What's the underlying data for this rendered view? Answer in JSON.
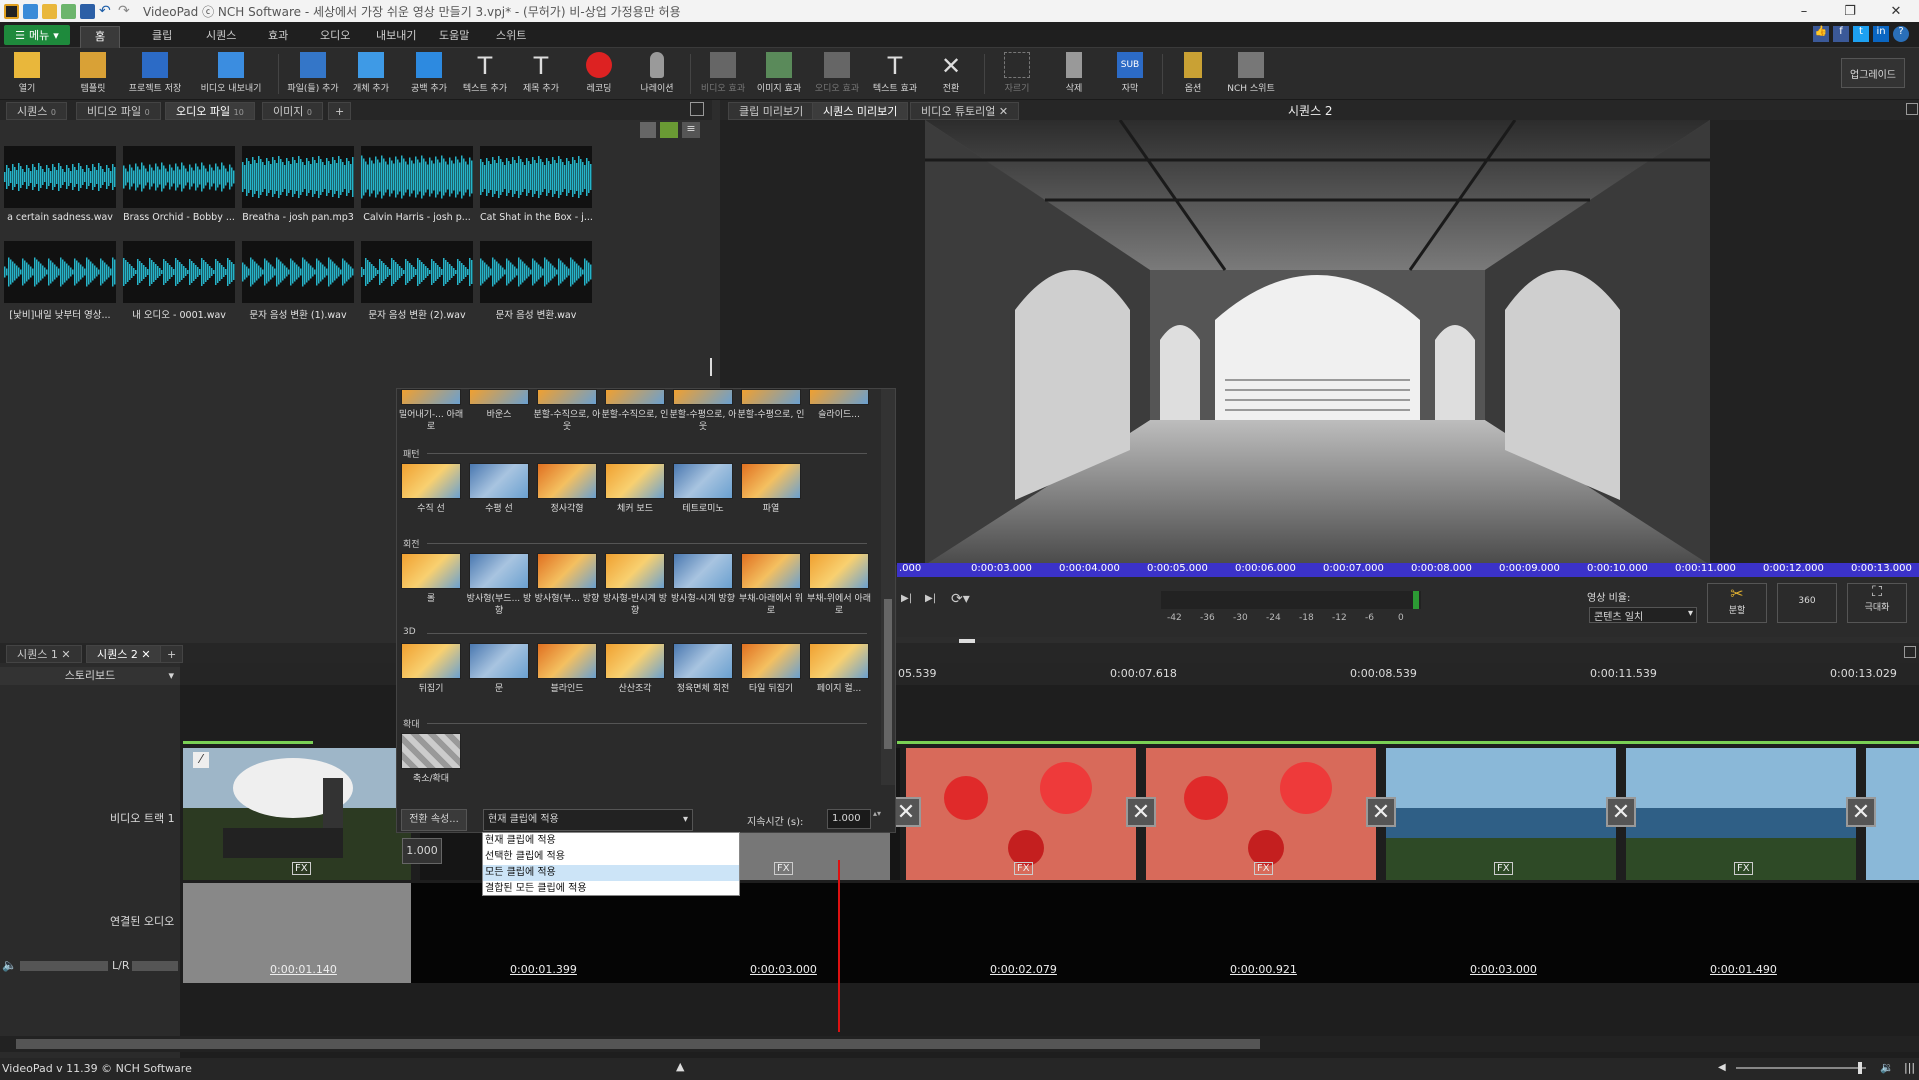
{
  "window": {
    "title": "VideoPad ⓒ NCH Software - 세상에서 가장 쉬운 영상 만들기 3.vpj* - (무허가) 비-상업 가정용만 허용",
    "minimize": "–",
    "maximize": "❐",
    "close": "✕"
  },
  "menubar": {
    "menu_label": "메뉴",
    "tabs": [
      "홈",
      "클립",
      "시퀀스",
      "효과",
      "오디오",
      "내보내기",
      "도움말",
      "스위트"
    ]
  },
  "toolbar": {
    "buttons": [
      "열기",
      "템플릿",
      "프로젝트 저장",
      "비디오 내보내기",
      "파일(들) 추가",
      "개체 추가",
      "공백 추가",
      "텍스트 추가",
      "제목 추가",
      "레코딩",
      "나레이션",
      "비디오 효과",
      "이미지 효과",
      "오디오 효과",
      "텍스트 효과",
      "전환",
      "자르기",
      "삭제",
      "자막",
      "옵션",
      "NCH 스위트"
    ],
    "upgrade": "업그레이드"
  },
  "bin": {
    "tabs": [
      "시퀀스",
      "비디오 파일",
      "오디오 파일",
      "이미지"
    ],
    "tab_counts": [
      "0",
      "0",
      "10",
      "0"
    ],
    "add_tab": "+",
    "clips": [
      "a certain sadness.wav",
      "Brass Orchid - Bobby ...",
      "Breatha - josh pan.mp3",
      "Calvin Harris - josh p...",
      "Cat Shat in the Box - j...",
      "[낯비]내일 낮부터 영상...",
      "내 오디오 - 0001.wav",
      "문자 음성 변환 (1).wav",
      "문자 음성 변환 (2).wav",
      "문자 음성 변환.wav"
    ]
  },
  "preview": {
    "tabs": [
      "클립 미리보기",
      "시퀀스 미리보기",
      "비디오 튜토리얼"
    ],
    "title": "시퀀스 2",
    "ruler": [
      ".000",
      "0:00:03.000",
      "0:00:04.000",
      "0:00:05.000",
      "0:00:06.000",
      "0:00:07.000",
      "0:00:08.000",
      "0:00:09.000",
      "0:00:10.000",
      "0:00:11.000",
      "0:00:12.000",
      "0:00:13.000"
    ],
    "meter_labels": [
      "-42",
      "-36",
      "-30",
      "-24",
      "-18",
      "-12",
      "-6",
      "0"
    ],
    "aspect_label": "영상 비율:",
    "aspect_value": "콘텐츠 일치",
    "split_label": "분할",
    "vr_label": "360",
    "fullscreen_label": "극대화"
  },
  "transitions": {
    "row0": [
      "밀어내기-... 아래로",
      "바운스",
      "분할-수직으로, 아웃",
      "분할-수직으로, 인",
      "분할-수평으로, 아웃",
      "분할-수평으로, 인",
      "슬라이드..."
    ],
    "section_pattern": "패턴",
    "pattern": [
      "수직 선",
      "수평 선",
      "정사각형",
      "체커 보드",
      "테트로미노",
      "파열"
    ],
    "section_rotate": "회전",
    "rotate": [
      "롤",
      "방사형(부드... 방향",
      "방사형(부... 방향",
      "방사형-반시계 방향",
      "방사형-시계 방향",
      "부채-아래에서 위로",
      "부채-위에서 아래로"
    ],
    "section_3d": "3D",
    "three_d": [
      "뒤집기",
      "문",
      "블라인드",
      "산산조각",
      "정육면체 회전",
      "타일 뒤집기",
      "페이지 컬..."
    ],
    "section_zoom": "확대",
    "zoom": [
      "축소/확대"
    ],
    "props_button": "전환 속성...",
    "apply_select": "현재 클립에 적용",
    "duration_label": "지속시간 (s):",
    "duration_value": "1.000",
    "options": [
      "현재 클립에 적용",
      "선택한 클립에 적용",
      "모든 클립에 적용",
      "결합된 모든 클립에 적용"
    ]
  },
  "sequence": {
    "tabs": [
      "시퀀스 1",
      "시퀀스 2"
    ],
    "add_tab": "+",
    "storyboard": "스토리보드",
    "track_video": "비디오 트랙 1",
    "track_audio": "연결된 오디오",
    "lr": "L/R",
    "ruler": [
      "05.539",
      "0:00:07.618",
      "0:00:08.539",
      "0:00:11.539",
      "0:00:13.029"
    ],
    "clip_duration_popup": "1.000",
    "durations": [
      "0:00:01.140",
      "0:00:01.399",
      "0:00:03.000",
      "0:00:02.079",
      "0:00:00.921",
      "0:00:03.000",
      "0:00:01.490"
    ],
    "fx": "FX"
  },
  "status": {
    "text": "VideoPad v 11.39 © NCH Software"
  },
  "colors": {
    "accent_green": "#1e8a3c",
    "wave": "#26b4c9",
    "ruler_blue": "#3b32c9",
    "playhead": "#d11"
  }
}
